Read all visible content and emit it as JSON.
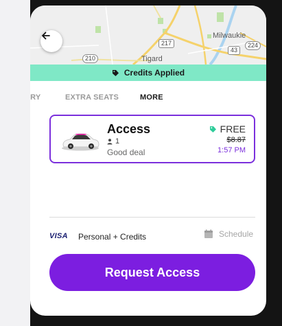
{
  "map": {
    "labels": {
      "milwaukie": "Milwaukie",
      "tigard": "Tigard"
    },
    "shields": {
      "r210": "210",
      "r217": "217",
      "r43": "43",
      "r224": "224"
    },
    "back_icon": "arrow-left-icon"
  },
  "banner": {
    "label": "Credits Applied",
    "icon": "tag-icon",
    "color": "#7fe8c6"
  },
  "tabs": [
    {
      "label": "URY"
    },
    {
      "label": "EXTRA SEATS"
    },
    {
      "label": "MORE",
      "active": true
    }
  ],
  "ride": {
    "name": "Access",
    "seats": "1",
    "description": "Good deal",
    "price": "FREE",
    "original_price": "$8.87",
    "eta": "1:57 PM",
    "accent": "#7b2fdc"
  },
  "payment": {
    "card_brand": "VISA",
    "method": "Personal + Credits",
    "schedule_label": "Schedule"
  },
  "request_button": {
    "label": "Request Access",
    "color": "#7c1ee0"
  }
}
